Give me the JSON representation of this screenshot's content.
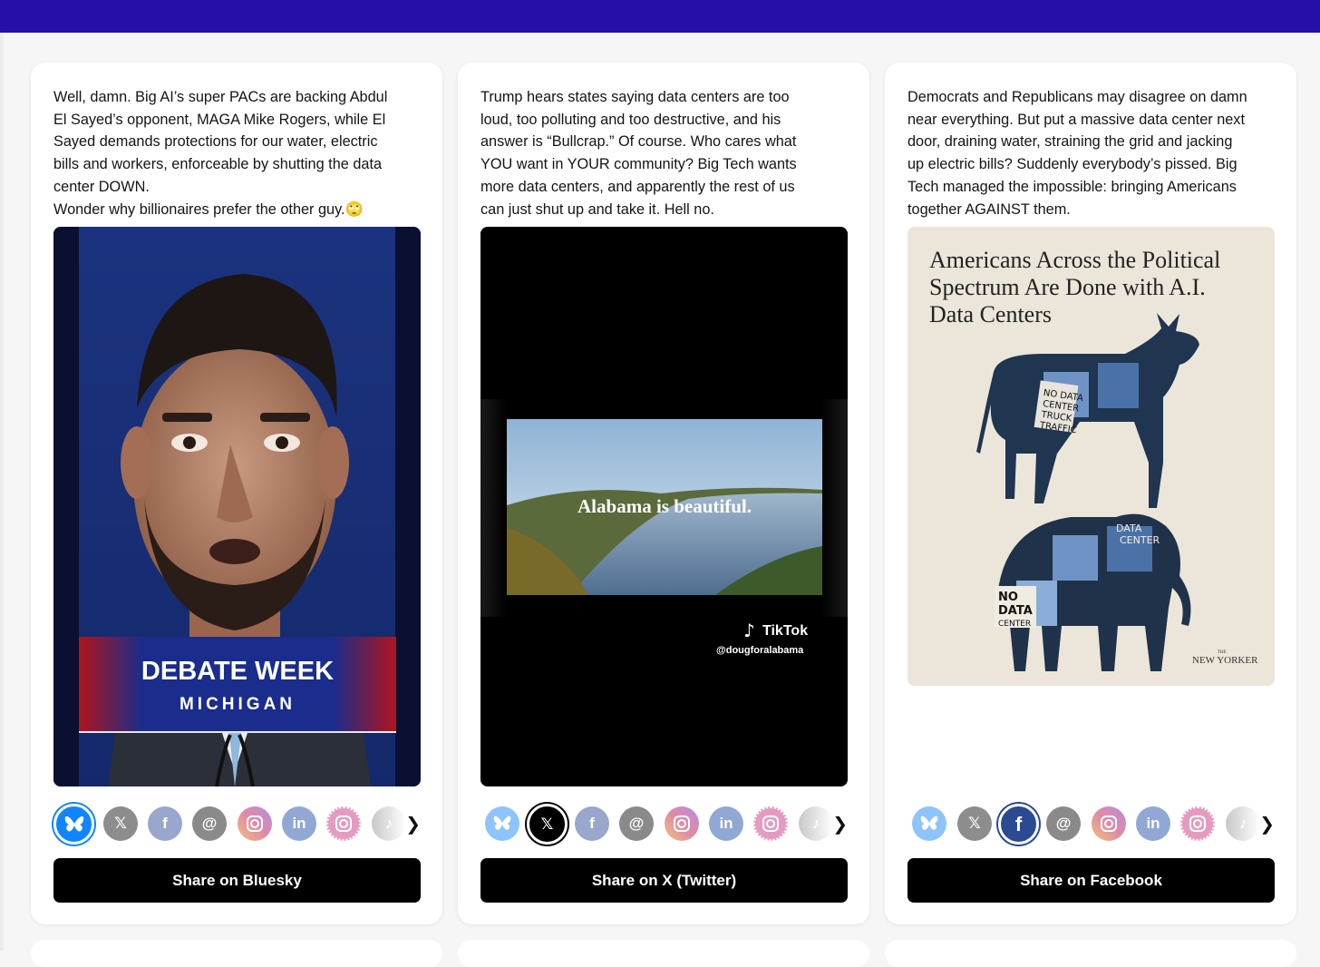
{
  "cards": [
    {
      "lines": [
        "Well, damn. Big AI’s super PACs are backing Abdul",
        "El Sayed’s opponent, MAGA Mike Rogers, while El",
        "Sayed demands protections for our water, electric",
        "bills and workers, enforceable by shutting the data",
        "center DOWN.",
        "Wonder why billionaires prefer the other guy."
      ],
      "emoji": "🙄",
      "media": {
        "banner_title": "DEBATE WEEK",
        "banner_subtitle": "MICHIGAN"
      },
      "share_label": "Share on Bluesky"
    },
    {
      "lines": [
        "Trump hears states saying data centers are too",
        "loud, too polluting and too destructive, and his",
        "answer is “Bullcrap.” Of course. Who cares what",
        "YOU want in YOUR community? Big Tech wants",
        "more data centers, and apparently the rest of us",
        "can just shut up and take it. Hell no."
      ],
      "media": {
        "overlay_text": "Alabama is beautiful.",
        "brand": "TikTok",
        "handle": "@dougforalabama"
      },
      "share_label": "Share on X (Twitter)"
    },
    {
      "lines": [
        "Democrats and Republicans may disagree on damn",
        "near everything. But put a massive data center next",
        "door, draining water, straining the grid and jacking",
        "up electric bills? Suddenly everybody’s pissed. Big",
        "Tech managed the impossible: bringing Americans",
        "together AGAINST them."
      ],
      "media": {
        "headline_lines": [
          "Americans Across the Political",
          "Spectrum Are Done with A.I.",
          "Data Centers"
        ],
        "masthead": "NEW YORKER",
        "masthead_small": "THE",
        "donkey_signs": [
          "NO DATA",
          "CENTER",
          "TRUCK",
          "TRAFFIC"
        ],
        "elephant_signs": [
          "DATA",
          "CENTER",
          "NO",
          "DATA",
          "CENTER"
        ]
      },
      "share_label": "Share on Facebook"
    }
  ],
  "share_icons": [
    "bluesky-icon",
    "x-icon",
    "facebook-icon",
    "threads-icon",
    "instagram-icon",
    "linkedin-icon",
    "instagram-alt-icon",
    "tiktok-icon"
  ],
  "icon_glyphs": {
    "x": "𝕏",
    "facebook": "f",
    "threads": "@",
    "linkedin": "in",
    "tiktok": "♪"
  },
  "more_chevron": "❯",
  "colors": {
    "topbar": "#2410a8",
    "bluesky": "#1185fe",
    "facebook": "#2a4a92",
    "share_button": "#000000"
  }
}
